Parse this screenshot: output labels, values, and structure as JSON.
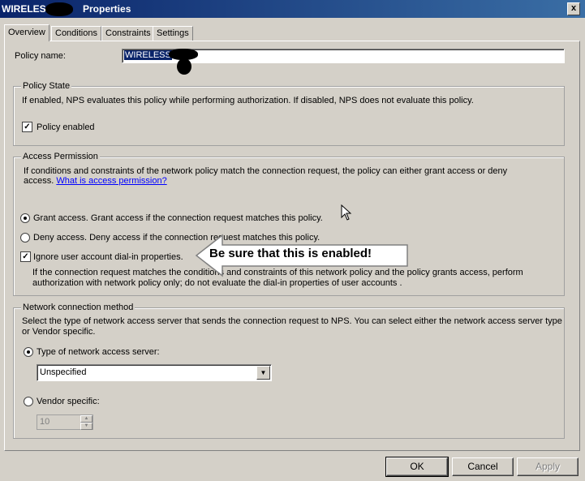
{
  "window": {
    "title_prefix": "WIRELESS",
    "title_suffix": " Properties",
    "close_glyph": "x"
  },
  "tabs": [
    {
      "label": "Overview",
      "active": true
    },
    {
      "label": "Conditions",
      "active": false
    },
    {
      "label": "Constraints",
      "active": false
    },
    {
      "label": "Settings",
      "active": false
    }
  ],
  "policy_name": {
    "label": "Policy name:",
    "value": "WIRELESS"
  },
  "policy_state": {
    "legend": "Policy State",
    "description": "If enabled, NPS evaluates this policy while performing authorization. If disabled, NPS does not evaluate this policy.",
    "enabled_label": "Policy enabled",
    "enabled_checked": true
  },
  "access_permission": {
    "legend": "Access Permission",
    "description_line1": "If conditions and constraints of the network policy match the connection request, the policy can either grant access or deny",
    "description_line2": "access.",
    "link": "What is access permission?",
    "grant_label": "Grant access. Grant access if the connection request matches this policy.",
    "deny_label": "Deny access. Deny access if the connection request matches this policy.",
    "ignore_label": "Ignore user account dial-in properties.",
    "ignore_checked": true,
    "ignore_desc_line1": "If the connection request matches the conditions and constraints of this network policy and the policy grants access, perform",
    "ignore_desc_line2": "authorization with network policy only; do not evaluate the dial-in properties of user accounts .",
    "selected": "grant"
  },
  "callout": {
    "text": "Be sure that this is enabled!"
  },
  "network_connection": {
    "legend": "Network connection method",
    "description_line1": "Select the type of network access server that sends the connection request to NPS. You can select either the network access server type",
    "description_line2": "or Vendor specific.",
    "type_label": "Type of network access server:",
    "type_value": "Unspecified",
    "vendor_label": "Vendor specific:",
    "vendor_value": "10",
    "selected": "type"
  },
  "buttons": {
    "ok": "OK",
    "cancel": "Cancel",
    "apply": "Apply"
  },
  "colors": {
    "titlebar": "#0a246a",
    "face": "#d4d0c8",
    "link": "#0000ff"
  }
}
